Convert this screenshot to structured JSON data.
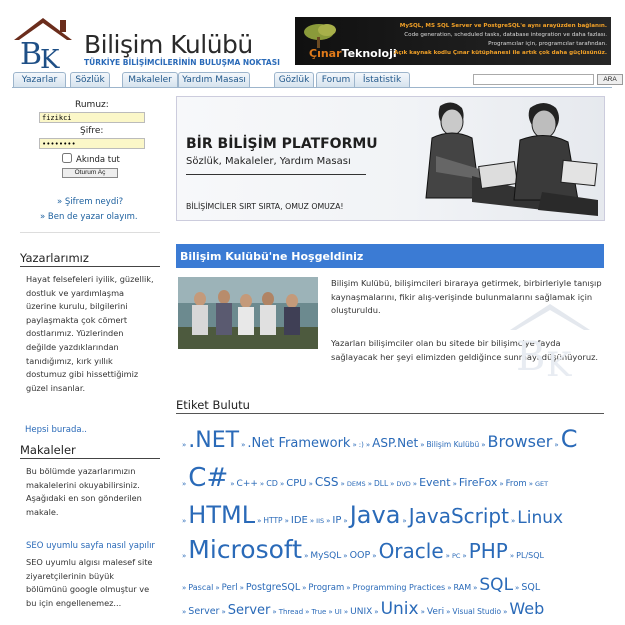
{
  "header": {
    "site_title": "Bilişim Kulübü",
    "tagline": "TÜRKİYE BİLİŞİMCİLERİNİN BULUŞMA NOKTASI",
    "logo_text": "BK"
  },
  "banner": {
    "brand_a": "Çınar",
    "brand_b": "Teknoloji",
    "lines": [
      "MySQL, MS SQL Server ve PostgreSQL'e aynı arayüzden bağlanın.",
      "Code generation, scheduled tasks, database integration ve daha fazlası.",
      "Programcılar için, programcılar tarafından.",
      "Açık kaynak kodlu Çınar kütüphanesi ile artık çok daha güçlüsünüz."
    ]
  },
  "nav": {
    "tabs": [
      "Yazarlar",
      "Sözlük",
      "Makaleler",
      "Yardım Masası",
      "Gözlük",
      "Forum",
      "İstatistik"
    ],
    "search_button": "ARA"
  },
  "login": {
    "username_label": "Rumuz:",
    "username_value": "fizikci",
    "password_label": "Şifre:",
    "password_value": "••••••••",
    "remember_label": "Akında tut",
    "login_button": "Oturum Aç",
    "forgot_link": "» Şifrem neydi?",
    "register_link": "» Ben de yazar olayım."
  },
  "sidebar": {
    "authors_title": "Yazarlarımız",
    "authors_text": "Hayat felsefeleri iyilik, güzellik, dostluk ve yardımlaşma üzerine kurulu, bilgilerini paylaşmakta çok cömert dostlarımız. Yüzlerinden değilde yazdıklarından tanıdığımız, kırk yıllık dostumuz gibi hissettiğimiz güzel insanlar.",
    "authors_more": "Hepsi burada..",
    "articles_title": "Makaleler",
    "articles_text": "Bu bölümde yazarlarımızın makalelerini okuyabilirsiniz. Aşağıdaki en son gönderilen makale.",
    "article_link": "SEO uyumlu sayfa nasıl yapılır",
    "article_excerpt": "SEO uyumlu algısı malesef site ziyaretçilerinin büyük bölümünü google olmuştur ve bu için engellenemez..."
  },
  "hero": {
    "title": "BİR BİLİŞİM PLATFORMU",
    "subtitle": "Sözlük, Makaleler, Yardım Masası",
    "slogan": "BİLİŞİMCİLER SIRT SIRTA, OMUZ OMUZA!"
  },
  "welcome": {
    "title": "Bilişim Kulübü'ne Hoşgeldiniz",
    "para1": "Bilişim Kulübü, bilişimcileri biraraya getirmek, birbirleriyle tanışıp kaynaşmalarını, fikir alış-verişinde bulunmalarını sağlamak için oluşturuldu.",
    "para2": "Yazarları bilişimciler olan bu sitede bir bilişimciye fayda sağlayacak her şeyi elimizden geldiğince sunmayı düşünüyoruz."
  },
  "tag_cloud": {
    "title": "Etiket Bulutu",
    "rows": [
      [
        {
          "t": ".NET",
          "s": 22
        },
        {
          "t": ".Net Framework",
          "s": 13
        },
        {
          "t": ":)",
          "s": 7
        },
        {
          "t": "ASP.Net",
          "s": 12
        },
        {
          "t": "Bilişim Kulübü",
          "s": 7.5
        },
        {
          "t": "Browser",
          "s": 16
        },
        {
          "t": "C",
          "s": 24
        }
      ],
      [
        {
          "t": "C#",
          "s": 26
        },
        {
          "t": "C++",
          "s": 9
        },
        {
          "t": "CD",
          "s": 8
        },
        {
          "t": "CPU",
          "s": 10
        },
        {
          "t": "CSS",
          "s": 12
        },
        {
          "t": "DEMS",
          "s": 6.5
        },
        {
          "t": "DLL",
          "s": 7.5
        },
        {
          "t": "DVD",
          "s": 6.5
        },
        {
          "t": "Event",
          "s": 11
        },
        {
          "t": "FireFox",
          "s": 11
        },
        {
          "t": "From",
          "s": 8.5
        },
        {
          "t": "GET",
          "s": 6.5
        }
      ],
      [
        {
          "t": "HTML",
          "s": 24
        },
        {
          "t": "HTTP",
          "s": 7.5
        },
        {
          "t": "IDE",
          "s": 10
        },
        {
          "t": "IIS",
          "s": 6.5
        },
        {
          "t": "IP",
          "s": 10
        },
        {
          "t": "Java",
          "s": 24
        },
        {
          "t": "JavaScript",
          "s": 20
        },
        {
          "t": "Linux",
          "s": 17
        }
      ],
      [
        {
          "t": "Microsoft",
          "s": 25
        },
        {
          "t": "MySQL",
          "s": 9
        },
        {
          "t": "OOP",
          "s": 9.5
        },
        {
          "t": "Oracle",
          "s": 20
        },
        {
          "t": "PC",
          "s": 6.5
        },
        {
          "t": "PHP",
          "s": 20
        },
        {
          "t": "PL/SQL",
          "s": 8
        }
      ],
      [
        {
          "t": "Pascal",
          "s": 8
        },
        {
          "t": "Perl",
          "s": 8.5
        },
        {
          "t": "PostgreSQL",
          "s": 9.5
        },
        {
          "t": "Program",
          "s": 8.5
        },
        {
          "t": "Programming Practices",
          "s": 8
        },
        {
          "t": "RAM",
          "s": 8
        },
        {
          "t": "SQL",
          "s": 17
        },
        {
          "t": "SQL",
          "s": 9.5
        }
      ],
      [
        {
          "t": "Server",
          "s": 9.5
        },
        {
          "t": "Server",
          "s": 13
        },
        {
          "t": "Thread",
          "s": 7
        },
        {
          "t": "True",
          "s": 7
        },
        {
          "t": "UI",
          "s": 7
        },
        {
          "t": "UNIX",
          "s": 9
        },
        {
          "t": "Unix",
          "s": 17
        },
        {
          "t": "Veri",
          "s": 9
        },
        {
          "t": "Visual Studio",
          "s": 7.5
        },
        {
          "t": "Web",
          "s": 16
        }
      ]
    ]
  },
  "colors": {
    "accent_blue": "#3b7bd4",
    "link_blue": "#2a6ab8",
    "banner_orange": "#f2a127"
  }
}
